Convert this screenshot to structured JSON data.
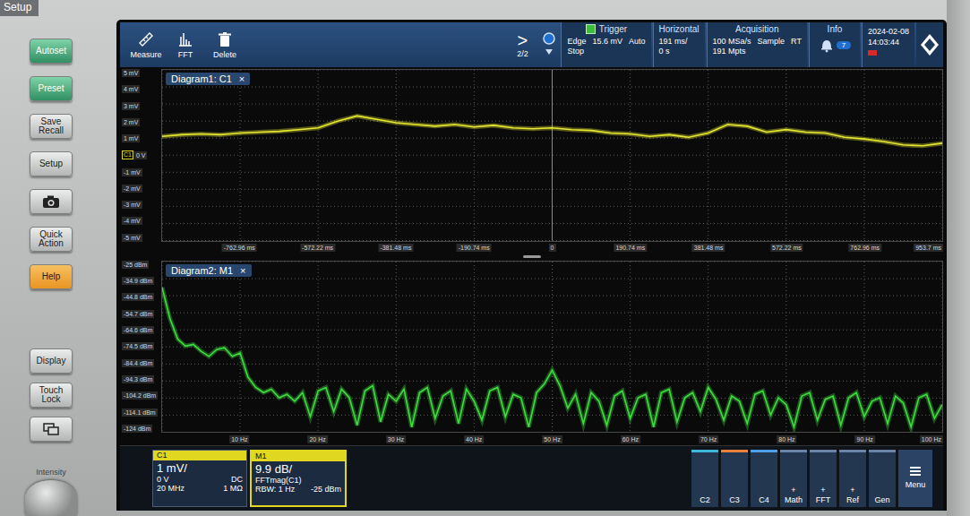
{
  "bezel": {
    "title": "Setup",
    "upper": [
      {
        "label": "Autoset",
        "kind": "green"
      },
      {
        "label": "Preset",
        "kind": "green"
      },
      {
        "label": "Save Recall",
        "kind": "gray"
      },
      {
        "label": "Setup",
        "kind": "gray"
      },
      {
        "kind": "camera"
      },
      {
        "label": "Quick Action",
        "kind": "gray"
      },
      {
        "label": "Help",
        "kind": "orange"
      }
    ],
    "lower": [
      {
        "label": "Display",
        "kind": "gray"
      },
      {
        "label": "Touch Lock",
        "kind": "gray"
      },
      {
        "kind": "windows"
      }
    ],
    "knob": "Intensity"
  },
  "toolbar": {
    "tools": [
      {
        "label": "Measure",
        "kind": "measure"
      },
      {
        "label": "FFT",
        "kind": "fft"
      },
      {
        "label": "Delete",
        "kind": "delete"
      }
    ],
    "next": ">",
    "page": "2/2",
    "status": [
      {
        "title": "Trigger",
        "ready": true,
        "rows": [
          [
            "Edge",
            "15.6 mV",
            "Auto"
          ],
          [
            "Stop"
          ]
        ]
      },
      {
        "title": "Horizontal",
        "ready": false,
        "rows": [
          [
            "191 ms/"
          ],
          [
            "0 s"
          ]
        ]
      },
      {
        "title": "Acquisition",
        "ready": false,
        "rows": [
          [
            "100 MSa/s",
            "Sample",
            "RT"
          ],
          [
            "191 Mpts"
          ]
        ]
      }
    ],
    "info": {
      "title": "Info",
      "badge": "7"
    },
    "clock": {
      "date": "2024-02-08",
      "time": "14:03:44"
    }
  },
  "diagrams": [
    {
      "title": "Diagram1: C1",
      "close": "×",
      "y_min": -5,
      "y_max": 5,
      "marker": {
        "label": "C1",
        "tick": 5
      },
      "y_ticks": [
        "5 mV",
        "4 mV",
        "3 mV",
        "2 mV",
        "1 mV",
        "0 V",
        "-1 mV",
        "-2 mV",
        "-3 mV",
        "-4 mV",
        "-5 mV"
      ],
      "x_ticks": [
        "-762.96 ms",
        "-572.22 ms",
        "-381.48 ms",
        "-190.74 ms",
        "0",
        "190.74 ms",
        "381.48 ms",
        "572.22 ms",
        "762.96 ms",
        "953.7 ms"
      ],
      "series": [
        {
          "name": "C1",
          "color": "#e6e832",
          "values": [
            1.1,
            1.2,
            1.25,
            1.2,
            1.3,
            1.35,
            1.4,
            1.5,
            1.6,
            2.0,
            2.3,
            2.1,
            1.9,
            1.8,
            1.7,
            1.8,
            1.65,
            1.75,
            1.6,
            1.55,
            1.6,
            1.5,
            1.45,
            1.3,
            1.25,
            1.1,
            1.2,
            1.05,
            1.3,
            1.8,
            1.7,
            1.35,
            1.5,
            1.35,
            1.3,
            1.05,
            0.95,
            0.8,
            0.6,
            0.55,
            0.7
          ]
        }
      ]
    },
    {
      "title": "Diagram2: M1",
      "close": "×",
      "y_min": -124,
      "y_max": -25,
      "y_ticks": [
        "-25 dBm",
        "-34.9 dBm",
        "-44.8 dBm",
        "-54.7 dBm",
        "-64.6 dBm",
        "-74.5 dBm",
        "-84.4 dBm",
        "-94.3 dBm",
        "-104.2 dBm",
        "-114.1 dBm",
        "-124 dBm"
      ],
      "x_ticks": [
        "10 Hz",
        "20 Hz",
        "30 Hz",
        "40 Hz",
        "50 Hz",
        "60 Hz",
        "70 Hz",
        "80 Hz",
        "90 Hz",
        "100 Hz"
      ],
      "series": [
        {
          "name": "M1",
          "color": "#3fdc3f",
          "values": [
            -40,
            -58,
            -70,
            -74,
            -73,
            -77,
            -80,
            -76,
            -75,
            -80,
            -78,
            -92,
            -98,
            -101,
            -99,
            -104,
            -102,
            -106,
            -101,
            -115,
            -100,
            -98,
            -112,
            -99,
            -104,
            -120,
            -100,
            -97,
            -118,
            -102,
            -106,
            -99,
            -121,
            -101,
            -98,
            -116,
            -103,
            -100,
            -119,
            -99,
            -106,
            -117,
            -100,
            -98,
            -115,
            -102,
            -104,
            -121,
            -101,
            -96,
            -88,
            -97,
            -110,
            -102,
            -119,
            -101,
            -106,
            -120,
            -103,
            -100,
            -116,
            -104,
            -102,
            -121,
            -101,
            -99,
            -118,
            -104,
            -101,
            -112,
            -98,
            -105,
            -117,
            -103,
            -106,
            -119,
            -102,
            -100,
            -114,
            -104,
            -108,
            -121,
            -103,
            -101,
            -117,
            -105,
            -103,
            -120,
            -104,
            -101,
            -115,
            -106,
            -104,
            -119,
            -103,
            -107,
            -121,
            -104,
            -102,
            -116,
            -108
          ]
        }
      ]
    }
  ],
  "channels": [
    {
      "name": "C1",
      "selected": false,
      "color": "#e0d820",
      "scale": "1 mV/",
      "rows": [
        [
          "0 V",
          "DC"
        ],
        [
          "20 MHz",
          "1 MΩ"
        ]
      ]
    },
    {
      "name": "M1",
      "selected": true,
      "color": "#e0d820",
      "scale": "9.9 dB/",
      "rows": [
        [
          "FFTmag(C1)",
          ""
        ],
        [
          "RBW: 1 Hz",
          "-25 dBm"
        ]
      ]
    }
  ],
  "buttons": [
    {
      "label": "C2",
      "color": "#3fb8d8"
    },
    {
      "label": "C3",
      "color": "#e8823a"
    },
    {
      "label": "C4",
      "color": "#4fa0e8"
    },
    {
      "label": "Math",
      "prefix": "+",
      "color": "#6a84a8"
    },
    {
      "label": "FFT",
      "prefix": "+",
      "color": "#6a84a8"
    },
    {
      "label": "Ref",
      "prefix": "+",
      "color": "#6a84a8"
    },
    {
      "label": "Gen",
      "color": "#6a84a8"
    }
  ],
  "menu": "Menu"
}
